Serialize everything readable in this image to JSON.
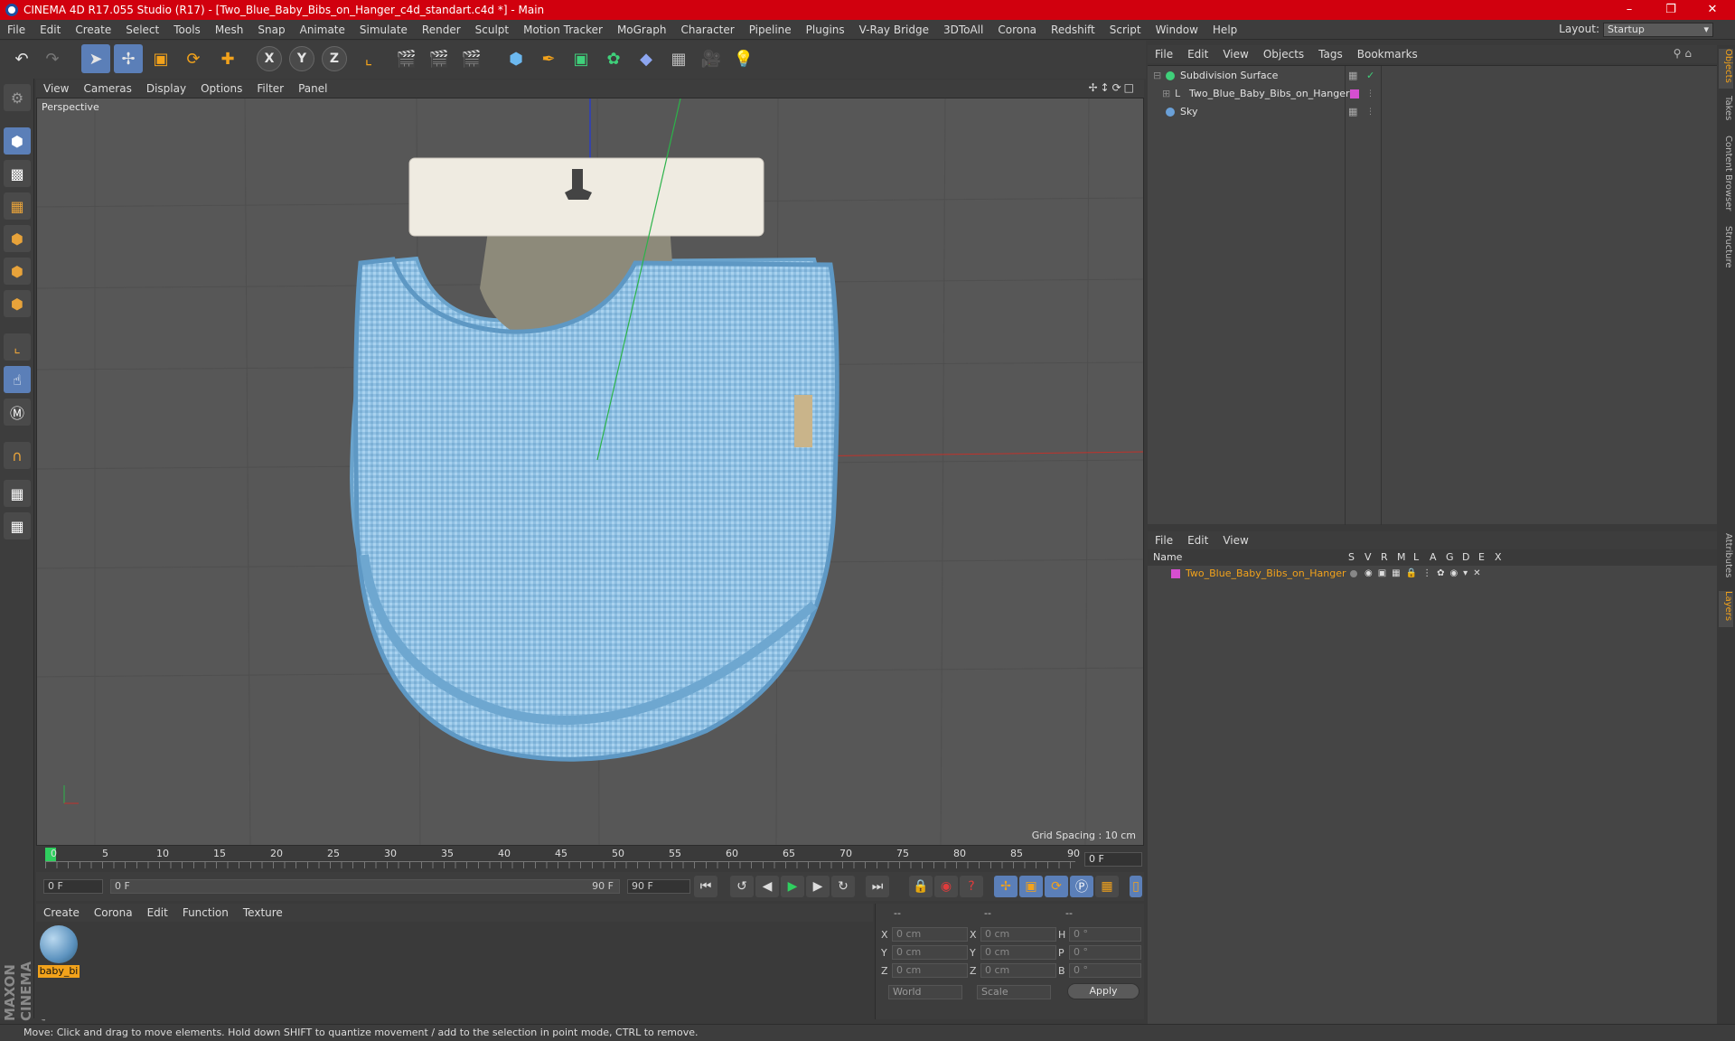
{
  "window": {
    "title": "CINEMA 4D R17.055 Studio (R17) - [Two_Blue_Baby_Bibs_on_Hanger_c4d_standart.c4d *] - Main"
  },
  "menu": [
    "File",
    "Edit",
    "Create",
    "Select",
    "Tools",
    "Mesh",
    "Snap",
    "Animate",
    "Simulate",
    "Render",
    "Sculpt",
    "Motion Tracker",
    "MoGraph",
    "Character",
    "Pipeline",
    "Plugins",
    "V-Ray Bridge",
    "3DToAll",
    "Corona",
    "Redshift",
    "Script",
    "Window",
    "Help"
  ],
  "layout": {
    "label": "Layout:",
    "value": "Startup"
  },
  "toolbar_axes": [
    "X",
    "Y",
    "Z"
  ],
  "viewport": {
    "menu": [
      "View",
      "Cameras",
      "Display",
      "Options",
      "Filter",
      "Panel"
    ],
    "camera": "Perspective",
    "grid_spacing": "Grid Spacing : 10 cm"
  },
  "timeline": {
    "ticks": [
      "0",
      "5",
      "10",
      "15",
      "20",
      "25",
      "30",
      "35",
      "40",
      "45",
      "50",
      "55",
      "60",
      "65",
      "70",
      "75",
      "80",
      "85",
      "90"
    ],
    "current_frame": "0 F",
    "start_field": "0 F",
    "range_start": "0 F",
    "range_end": "90 F",
    "end_field": "90 F"
  },
  "materials": {
    "menu": [
      "Create",
      "Corona",
      "Edit",
      "Function",
      "Texture"
    ],
    "items": [
      {
        "label": "baby_bi"
      }
    ]
  },
  "coordinates": {
    "headers": [
      "--",
      "--",
      "--"
    ],
    "rows": [
      {
        "a": "X",
        "av": "0 cm",
        "b": "X",
        "bv": "0 cm",
        "c": "H",
        "cv": "0 °"
      },
      {
        "a": "Y",
        "av": "0 cm",
        "b": "Y",
        "bv": "0 cm",
        "c": "P",
        "cv": "0 °"
      },
      {
        "a": "Z",
        "av": "0 cm",
        "b": "Z",
        "bv": "0 cm",
        "c": "B",
        "cv": "0 °"
      }
    ],
    "mode": "World",
    "scale": "Scale",
    "apply": "Apply"
  },
  "objects": {
    "menu": [
      "File",
      "Edit",
      "View",
      "Objects",
      "Tags",
      "Bookmarks"
    ],
    "items": [
      {
        "name": "Subdivision Surface",
        "color": "#3fd07a"
      },
      {
        "name": "Two_Blue_Baby_Bibs_on_Hanger",
        "color": "#d64fd0"
      },
      {
        "name": "Sky",
        "color": "#6aa0d8"
      }
    ]
  },
  "layers": {
    "menu": [
      "File",
      "Edit",
      "View"
    ],
    "columns": [
      "Name",
      "S",
      "V",
      "R",
      "M",
      "L",
      "A",
      "G",
      "D",
      "E",
      "X"
    ],
    "items": [
      {
        "name": "Two_Blue_Baby_Bibs_on_Hanger",
        "color": "#d64fd0"
      }
    ]
  },
  "right_tabs": [
    "Objects",
    "Takes",
    "Content Browser",
    "Structure",
    "Attributes",
    "Layers"
  ],
  "brand": "MAXON CINEMA 4D",
  "status": "Move: Click and drag to move elements. Hold down SHIFT to quantize movement / add to the selection in point mode, CTRL to remove.",
  "colors": {
    "title_bar": "#d1000e",
    "accent": "#f2a21b",
    "active_tool": "#5b7fb8"
  }
}
